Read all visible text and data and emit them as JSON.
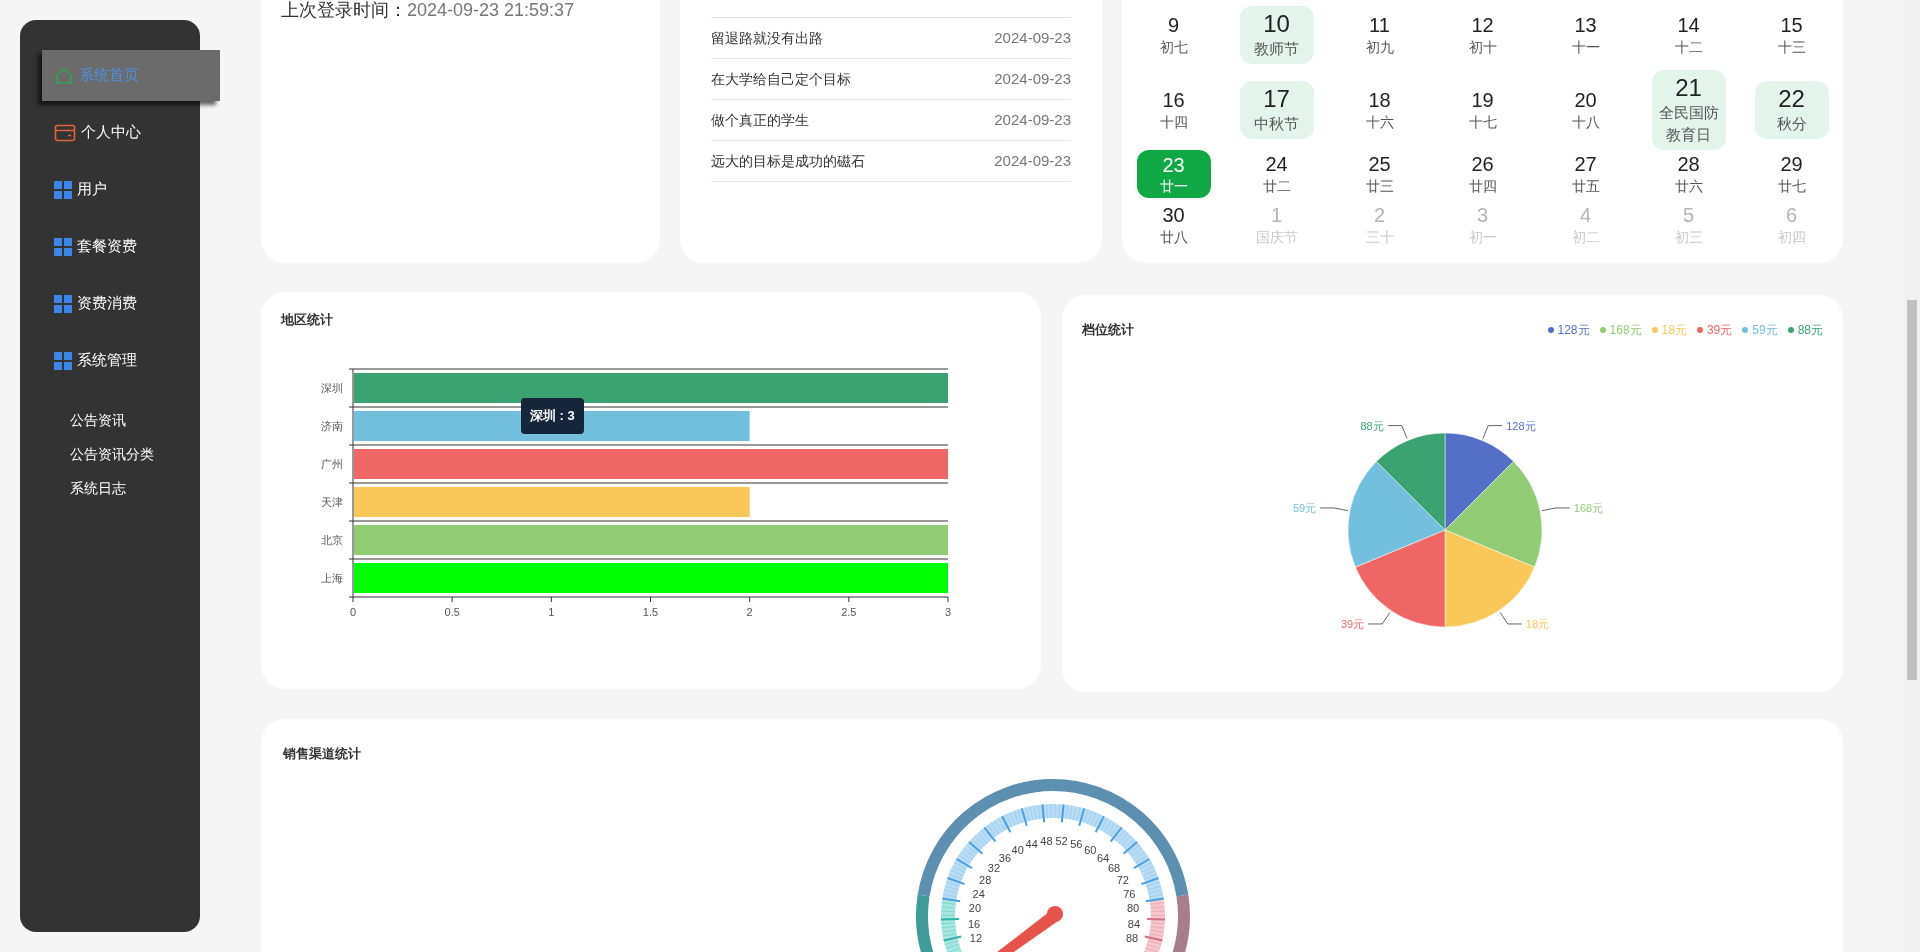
{
  "sidebar": {
    "items": [
      {
        "label": "系统首页",
        "selected": true
      },
      {
        "label": "个人中心",
        "selected": false
      },
      {
        "label": "用户",
        "selected": false
      },
      {
        "label": "套餐资费",
        "selected": false
      },
      {
        "label": "资费消费",
        "selected": false
      },
      {
        "label": "系统管理",
        "selected": false,
        "children": [
          {
            "label": "公告资讯",
            "selected": false
          },
          {
            "label": "公告资讯分类",
            "selected": false
          },
          {
            "label": "系统日志",
            "selected": false
          }
        ]
      }
    ]
  },
  "login_card": {
    "label": "上次登录时间：",
    "value": "2024-09-23 21:59:37"
  },
  "news": {
    "rows": [
      {
        "title": "留退路就没有出路",
        "date": "2024-09-23"
      },
      {
        "title": "在大学给自己定个目标",
        "date": "2024-09-23"
      },
      {
        "title": "做个真正的学生",
        "date": "2024-09-23"
      },
      {
        "title": "远大的目标是成功的磁石",
        "date": "2024-09-23"
      }
    ]
  },
  "calendar": {
    "weeks": [
      [
        {
          "day": "9",
          "lunar": "初七",
          "kind": "normal"
        },
        {
          "day": "10",
          "lunar": "教师节",
          "kind": "festival"
        },
        {
          "day": "11",
          "lunar": "初九",
          "kind": "normal"
        },
        {
          "day": "12",
          "lunar": "初十",
          "kind": "normal"
        },
        {
          "day": "13",
          "lunar": "十一",
          "kind": "normal"
        },
        {
          "day": "14",
          "lunar": "十二",
          "kind": "normal"
        },
        {
          "day": "15",
          "lunar": "十三",
          "kind": "normal"
        }
      ],
      [
        {
          "day": "16",
          "lunar": "十四",
          "kind": "normal"
        },
        {
          "day": "17",
          "lunar": "中秋节",
          "kind": "festival"
        },
        {
          "day": "18",
          "lunar": "十六",
          "kind": "normal"
        },
        {
          "day": "19",
          "lunar": "十七",
          "kind": "normal"
        },
        {
          "day": "20",
          "lunar": "十八",
          "kind": "normal"
        },
        {
          "day": "21",
          "lunar": "全民国防教育日",
          "kind": "festival"
        },
        {
          "day": "22",
          "lunar": "秋分",
          "kind": "festival"
        }
      ],
      [
        {
          "day": "23",
          "lunar": "廿一",
          "kind": "today"
        },
        {
          "day": "24",
          "lunar": "廿二",
          "kind": "normal"
        },
        {
          "day": "25",
          "lunar": "廿三",
          "kind": "normal"
        },
        {
          "day": "26",
          "lunar": "廿四",
          "kind": "normal"
        },
        {
          "day": "27",
          "lunar": "廿五",
          "kind": "normal"
        },
        {
          "day": "28",
          "lunar": "廿六",
          "kind": "normal"
        },
        {
          "day": "29",
          "lunar": "廿七",
          "kind": "normal"
        }
      ],
      [
        {
          "day": "30",
          "lunar": "廿八",
          "kind": "normal"
        },
        {
          "day": "1",
          "lunar": "国庆节",
          "kind": "other"
        },
        {
          "day": "2",
          "lunar": "三十",
          "kind": "other"
        },
        {
          "day": "3",
          "lunar": "初一",
          "kind": "other"
        },
        {
          "day": "4",
          "lunar": "初二",
          "kind": "other"
        },
        {
          "day": "5",
          "lunar": "初三",
          "kind": "other"
        },
        {
          "day": "6",
          "lunar": "初四",
          "kind": "other"
        }
      ]
    ]
  },
  "region_chart": {
    "title": "地区统计",
    "tooltip": "深圳 : 3",
    "chart_data": {
      "type": "bar",
      "orientation": "horizontal",
      "categories": [
        "深圳",
        "济南",
        "广州",
        "天津",
        "北京",
        "上海"
      ],
      "values": [
        3,
        2,
        3,
        2,
        3,
        3
      ],
      "colors": [
        "#3ba272",
        "#73c0de",
        "#ee6666",
        "#fac858",
        "#91cc75",
        "#00ff00"
      ],
      "xlim": [
        0,
        3
      ],
      "xticks": [
        0,
        0.5,
        1,
        1.5,
        2,
        2.5,
        3
      ]
    }
  },
  "tier_chart": {
    "title": "档位统计",
    "legend": [
      {
        "label": "128元",
        "color": "#5470c6"
      },
      {
        "label": "168元",
        "color": "#91cc75"
      },
      {
        "label": "18元",
        "color": "#fac858"
      },
      {
        "label": "39元",
        "color": "#ee6666"
      },
      {
        "label": "59元",
        "color": "#73c0de"
      },
      {
        "label": "88元",
        "color": "#3ba272"
      }
    ],
    "chart_data": {
      "type": "pie",
      "categories": [
        "128元",
        "168元",
        "18元",
        "39元",
        "59元",
        "88元"
      ],
      "values": [
        12.5,
        18.75,
        18.75,
        18.75,
        18.75,
        12.5
      ],
      "colors": [
        "#5470c6",
        "#91cc75",
        "#fac858",
        "#ee6666",
        "#73c0de",
        "#3ba272"
      ]
    }
  },
  "channel_chart": {
    "title": "销售渠道统计",
    "gauge_ticks": [
      "44",
      "48",
      "52",
      "56",
      "40",
      "60",
      "36",
      "64",
      "32",
      "68",
      "28",
      "72",
      "24",
      "76",
      "20",
      "80",
      "16",
      "84",
      "12",
      "88"
    ]
  }
}
